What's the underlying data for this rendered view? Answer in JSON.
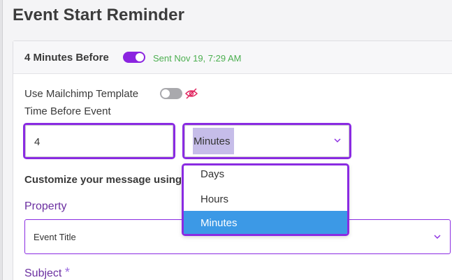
{
  "page": {
    "title": "Event Start Reminder"
  },
  "reminder": {
    "header_title": "4 Minutes Before",
    "enabled": true,
    "sent_text": "Sent Nov 19, 7:29 AM"
  },
  "form": {
    "mailchimp_label": "Use Mailchimp Template",
    "mailchimp_enabled": false,
    "time_label": "Time Before Event",
    "time_value": "4",
    "unit_value": "Minutes",
    "customize_label": "Customize your message using",
    "property_label": "Property",
    "property_value": "Event Title",
    "subject_label": "Subject",
    "subject_required_mark": "*"
  },
  "unit_dropdown": {
    "options": [
      "Days",
      "Hours",
      "Minutes"
    ],
    "selected": "Minutes"
  },
  "colors": {
    "accent_purple": "#8b24e0",
    "sent_green": "#4caf50",
    "selected_blue": "#3c99e6"
  },
  "icons": {
    "eye_off": "eye-off-icon",
    "chevron": "chevron-down-icon"
  }
}
